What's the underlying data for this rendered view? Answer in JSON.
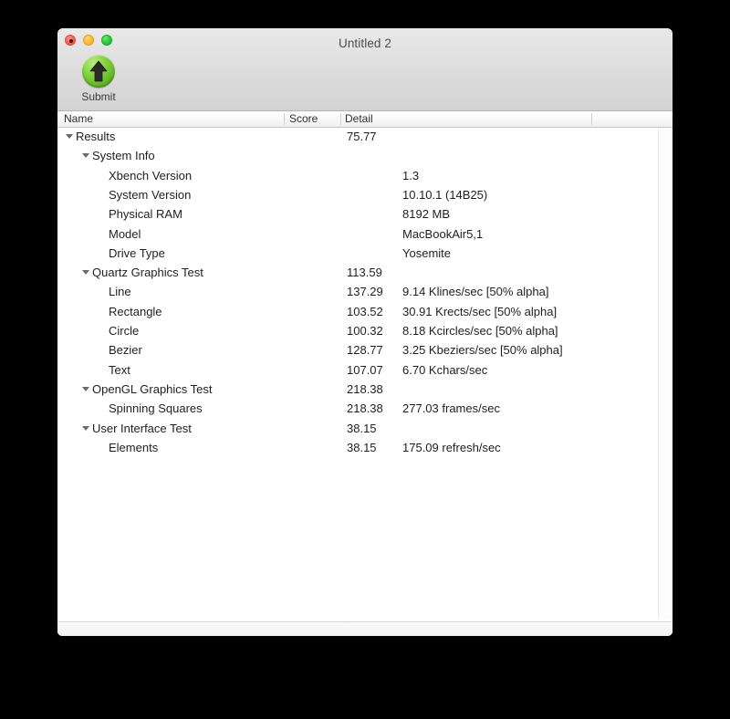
{
  "window": {
    "title": "Untitled 2",
    "traffic_lights": [
      {
        "name": "close",
        "color": "#ff5f56"
      },
      {
        "name": "minimize",
        "color": "#ffbd2e"
      },
      {
        "name": "maximize",
        "color": "#28c840"
      }
    ]
  },
  "toolbar": {
    "submit_label": "Submit",
    "submit_icon": "green-up-arrow-icon",
    "submit_icon_color": "#8bd848"
  },
  "columns": {
    "name": "Name",
    "score": "Score",
    "detail": "Detail"
  },
  "rows": [
    {
      "level": 0,
      "expandable": true,
      "name": "Results",
      "score": "75.77",
      "detail": ""
    },
    {
      "level": 1,
      "expandable": true,
      "name": "System Info",
      "score": "",
      "detail": ""
    },
    {
      "level": 2,
      "expandable": false,
      "name": "Xbench Version",
      "score": "",
      "detail": "1.3"
    },
    {
      "level": 2,
      "expandable": false,
      "name": "System Version",
      "score": "",
      "detail": "10.10.1 (14B25)"
    },
    {
      "level": 2,
      "expandable": false,
      "name": "Physical RAM",
      "score": "",
      "detail": "8192 MB"
    },
    {
      "level": 2,
      "expandable": false,
      "name": "Model",
      "score": "",
      "detail": "MacBookAir5,1"
    },
    {
      "level": 2,
      "expandable": false,
      "name": "Drive Type",
      "score": "",
      "detail": "Yosemite"
    },
    {
      "level": 1,
      "expandable": true,
      "name": "Quartz Graphics Test",
      "score": "113.59",
      "detail": ""
    },
    {
      "level": 2,
      "expandable": false,
      "name": "Line",
      "score": "137.29",
      "detail": "9.14 Klines/sec [50% alpha]"
    },
    {
      "level": 2,
      "expandable": false,
      "name": "Rectangle",
      "score": "103.52",
      "detail": "30.91 Krects/sec [50% alpha]"
    },
    {
      "level": 2,
      "expandable": false,
      "name": "Circle",
      "score": "100.32",
      "detail": "8.18 Kcircles/sec [50% alpha]"
    },
    {
      "level": 2,
      "expandable": false,
      "name": "Bezier",
      "score": "128.77",
      "detail": "3.25 Kbeziers/sec [50% alpha]"
    },
    {
      "level": 2,
      "expandable": false,
      "name": "Text",
      "score": "107.07",
      "detail": "6.70 Kchars/sec"
    },
    {
      "level": 1,
      "expandable": true,
      "name": "OpenGL Graphics Test",
      "score": "218.38",
      "detail": ""
    },
    {
      "level": 2,
      "expandable": false,
      "name": "Spinning Squares",
      "score": "218.38",
      "detail": "277.03 frames/sec"
    },
    {
      "level": 1,
      "expandable": true,
      "name": "User Interface Test",
      "score": "38.15",
      "detail": ""
    },
    {
      "level": 2,
      "expandable": false,
      "name": "Elements",
      "score": "38.15",
      "detail": "175.09 refresh/sec"
    }
  ]
}
